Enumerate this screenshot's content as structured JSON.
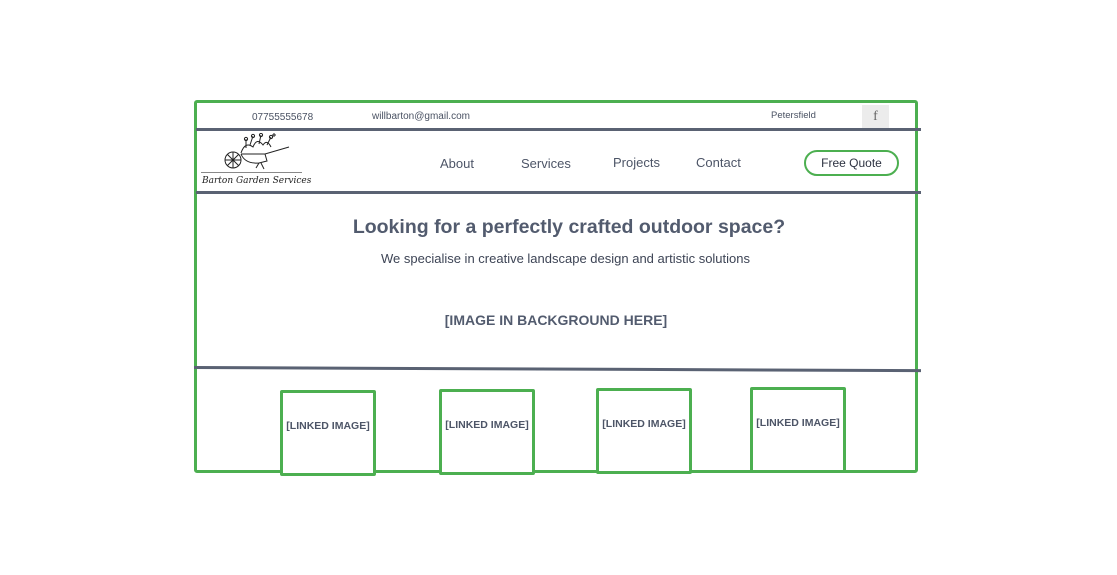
{
  "topbar": {
    "phone": "07755555678",
    "email": "willbarton@gmail.com",
    "location": "Petersfield",
    "social_icon": "facebook-icon",
    "social_glyph": "f"
  },
  "logo": {
    "text": "Barton Garden Services"
  },
  "nav": {
    "items": [
      "About",
      "Services",
      "Projects",
      "Contact"
    ],
    "cta_label": "Free Quote"
  },
  "hero": {
    "title": "Looking for a perfectly crafted outdoor space?",
    "subtitle": "We specialise in creative landscape design and artistic solutions",
    "image_placeholder": "[IMAGE IN BACKGROUND HERE]"
  },
  "tiles": [
    {
      "label": "[LINKED IMAGE]"
    },
    {
      "label": "[LINKED IMAGE]"
    },
    {
      "label": "[LINKED IMAGE]"
    },
    {
      "label": "[LINKED IMAGE]"
    }
  ],
  "colors": {
    "accent": "#4caf50",
    "rule": "#5a6273",
    "text": "#525b6e"
  }
}
